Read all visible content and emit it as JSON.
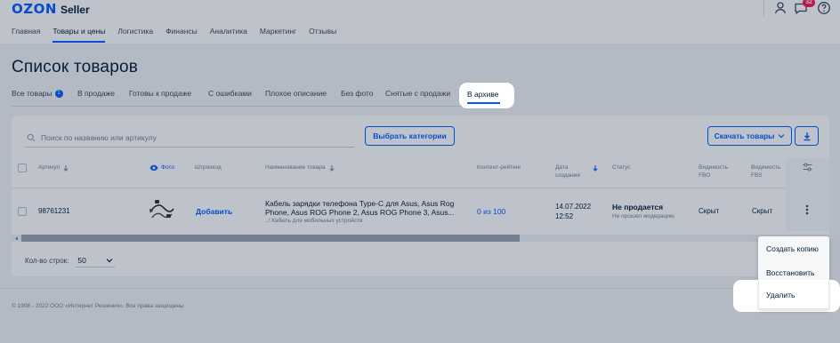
{
  "header": {
    "logo_brand": "OZON",
    "logo_product": "Seller",
    "notification_count": "32",
    "icons": [
      "user-icon",
      "chat-icon",
      "help-icon"
    ]
  },
  "nav": {
    "items": [
      "Главная",
      "Товары и цены",
      "Логистика",
      "Финансы",
      "Аналитика",
      "Маркетинг",
      "Отзывы"
    ],
    "active": "Товары и цены"
  },
  "page": {
    "title": "Список товаров"
  },
  "tabs": {
    "items": [
      "Все товары",
      "В продаже",
      "Готовы к продаже",
      "С ошибками",
      "Плохое описание",
      "Без фото",
      "Снятые с продажи",
      "В архиве"
    ],
    "all_count": "1",
    "active": "В архиве"
  },
  "toolbar": {
    "search_placeholder": "Поиск по названию или артикулу",
    "select_categories": "Выбрать категории",
    "download_products": "Скачать товары"
  },
  "table": {
    "columns": {
      "article": "Артикул",
      "photo": "Фото",
      "barcode": "Штрихкод",
      "name": "Наименование товара",
      "content_rating": "Контент-рейтинг",
      "created_line1": "Дата",
      "created_line2": "создания",
      "status": "Статус",
      "vis_fbo_line1": "Видимость",
      "vis_fbo_line2": "FBO",
      "vis_fbs_line1": "Видимость",
      "vis_fbs_line2": "FBS"
    },
    "rows": [
      {
        "article": "98761231",
        "barcode_action": "Добавить",
        "name_line1": "Кабель зарядки телефона Type-C для Asus, Asus Rog",
        "name_line2": "Phone, Asus ROG Phone 2, Asus ROG Phone 3, Asus...",
        "category": "../ Кабель для мобильных устройств",
        "content_rating": "0 из 100",
        "date": "14.07.2022",
        "time": "12:52",
        "status": "Не продается",
        "status_reason": "Не прошел модерацию",
        "vis_fbo": "Скрыт",
        "vis_fbs": "Скрыт"
      }
    ]
  },
  "pagination": {
    "rows_label": "Кол-во строк:",
    "rows_value": "50"
  },
  "row_menu": {
    "items": [
      "Создать копию",
      "Восстановить",
      "Удалить"
    ]
  },
  "footer": {
    "copyright": "© 1998 - 2022 ООО «Интернет Решения». Все права защищены"
  },
  "colors": {
    "brand": "#005bff",
    "badge": "#f91155",
    "text": "#001a34",
    "muted": "#707f8d"
  }
}
